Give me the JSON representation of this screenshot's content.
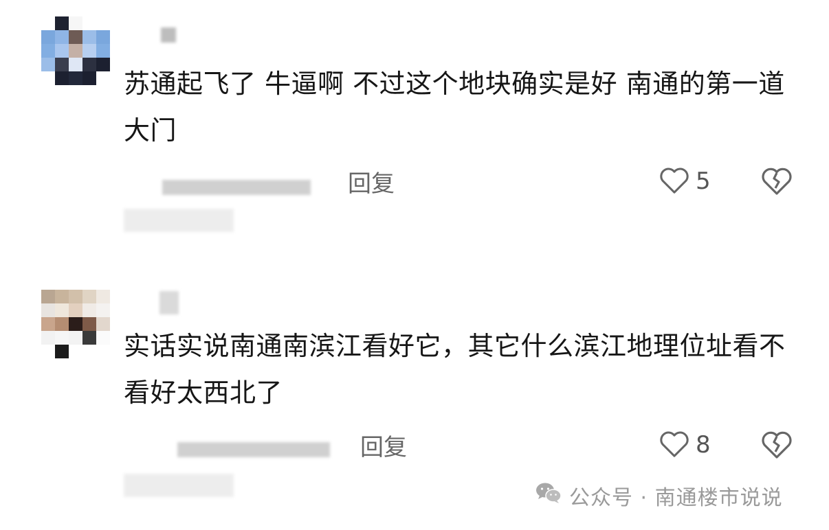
{
  "comments": [
    {
      "text": "苏通起飞了  牛逼啊 不过这个地块确实是好  南通的第一道大门",
      "reply_label": "回复",
      "like_count": "5"
    },
    {
      "text": "实话实说南通南滨江看好它，其它什么滨江地理位址看不看好太西北了",
      "reply_label": "回复",
      "like_count": "8"
    }
  ],
  "watermark": {
    "text": "公众号 · 南通楼市说说"
  },
  "icons": {
    "like": "heart-outline-icon",
    "dislike": "broken-heart-icon",
    "watermark": "wechat-icon"
  },
  "colors": {
    "text": "#161616",
    "muted": "#666666",
    "watermark": "#9a9a9a"
  }
}
